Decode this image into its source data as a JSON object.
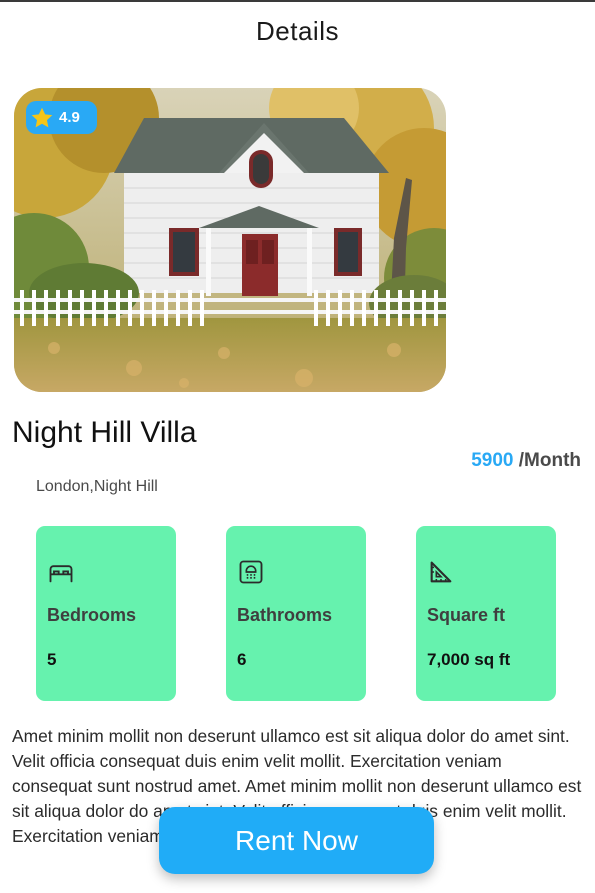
{
  "header": {
    "title": "Details"
  },
  "hero": {
    "image_alt": "White house with red door"
  },
  "rating": {
    "value": "4.9",
    "icon": "star-icon"
  },
  "property": {
    "name": "Night Hill Villa",
    "location": "London,Night Hill",
    "price": "5900",
    "price_period": " /Month"
  },
  "features": [
    {
      "icon": "bed-icon",
      "label": "Bedrooms",
      "value": "5"
    },
    {
      "icon": "bathroom-icon",
      "label": "Bathrooms",
      "value": "6"
    },
    {
      "icon": "area-icon",
      "label": "Square ft",
      "value": "7,000 sq ft"
    }
  ],
  "description": "Amet minim mollit non deserunt ullamco est sit aliqua dolor do amet sint. Velit officia consequat duis enim velit mollit. Exercitation veniam consequat sunt nostrud amet. Amet minim mollit non deserunt ullamco est sit aliqua dolor do amet sint. Velit officia consequat duis enim velit mollit. Exercitation veniam consequat sunt nostrud amet",
  "actions": {
    "rent_label": "Rent Now"
  },
  "colors": {
    "accent": "#29a9f5",
    "card": "#66f2ae",
    "button": "#20acf7"
  }
}
